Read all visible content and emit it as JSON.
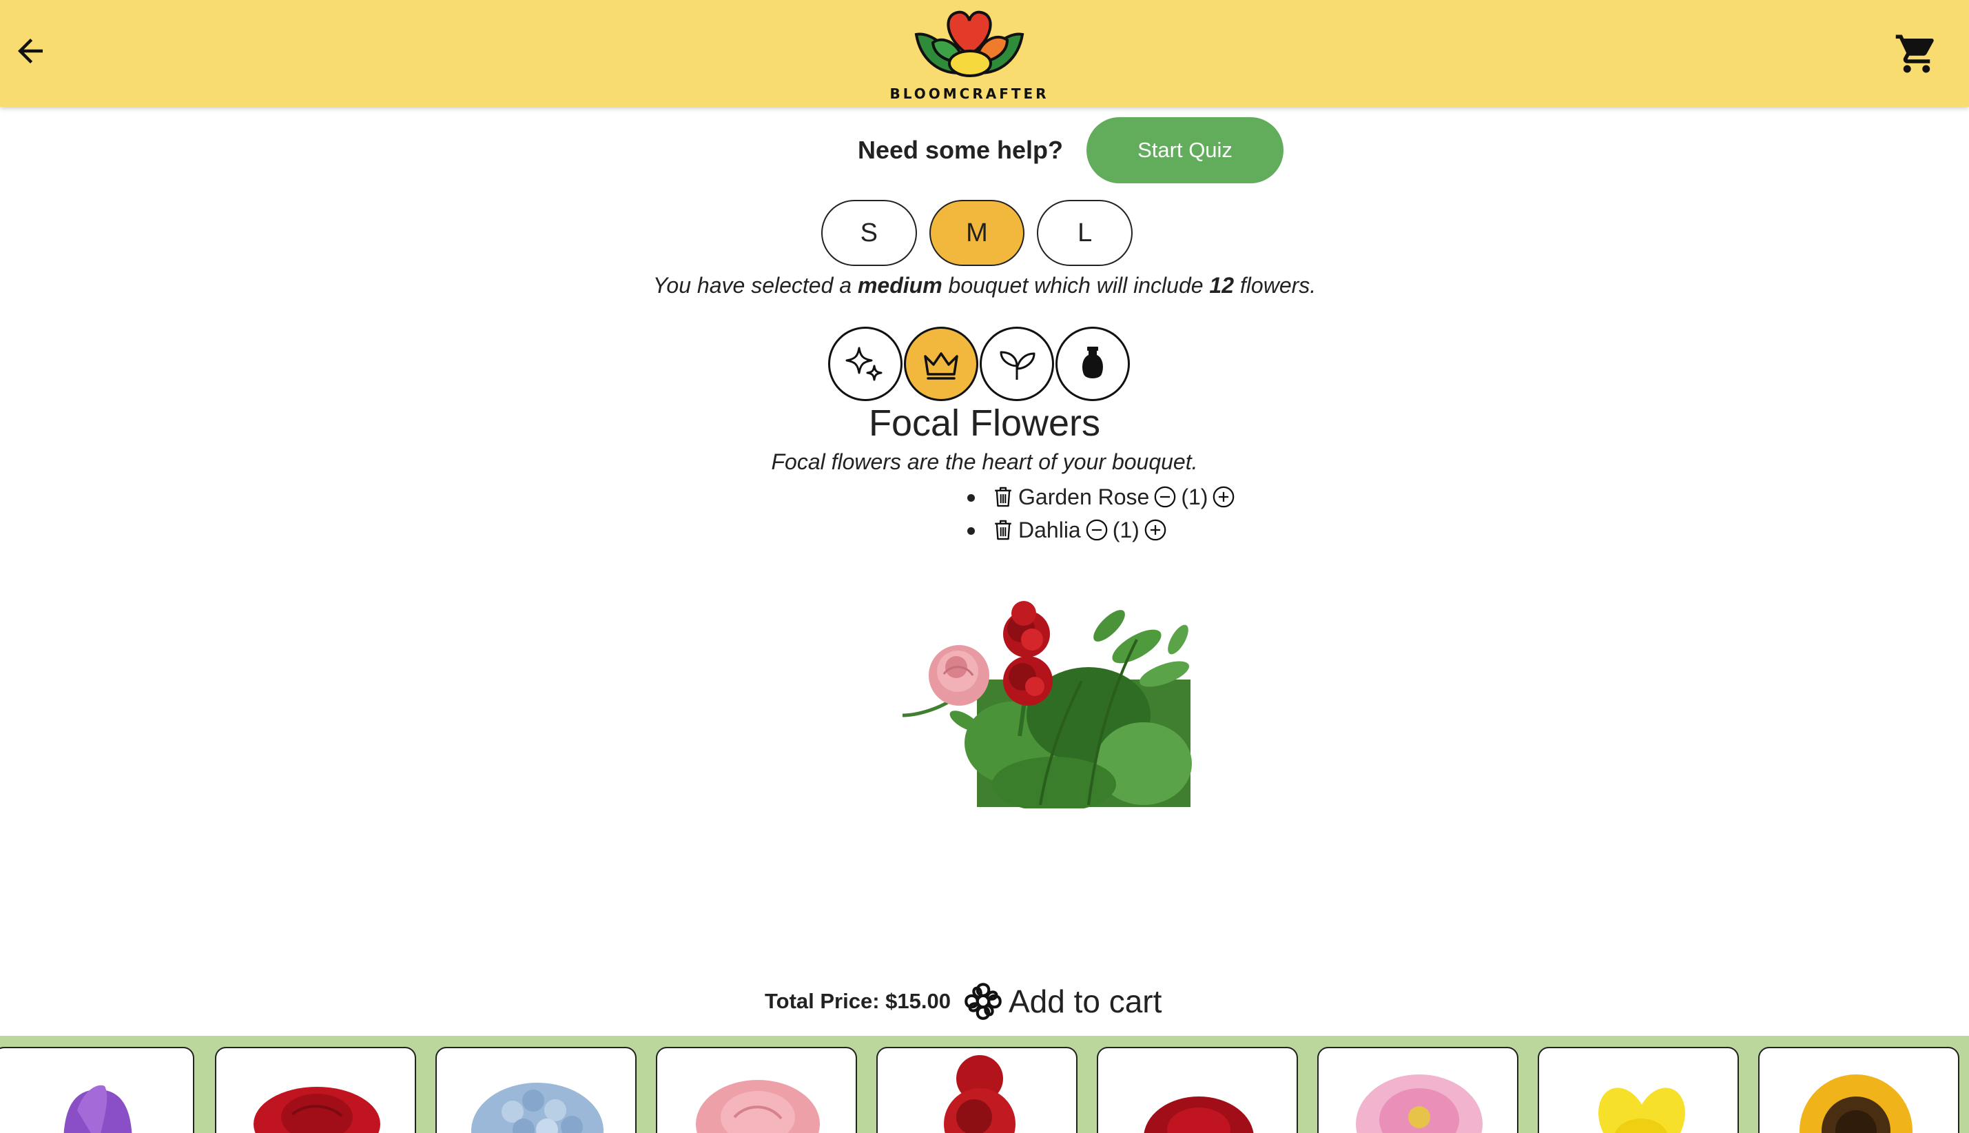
{
  "header": {
    "logo_text": "BLOOMCRAFTER",
    "back_icon": "arrow-left-icon",
    "cart_icon": "shopping-cart-icon",
    "bg_color": "#f8dc70"
  },
  "help": {
    "text": "Need some help?",
    "quiz_button": "Start Quiz",
    "quiz_color": "#62ad5b"
  },
  "sizes": {
    "options": [
      "S",
      "M",
      "L"
    ],
    "selected": "M",
    "accent": "#f2b73d"
  },
  "selection": {
    "prefix": "You have selected a ",
    "size_word": "medium",
    "middle": " bouquet which will include ",
    "count": "12",
    "suffix": " flowers."
  },
  "categories": {
    "icons": [
      "sparkles-icon",
      "crown-icon",
      "sprout-icon",
      "vase-icon"
    ],
    "selected_index": 1,
    "title": "Focal Flowers",
    "description": "Focal flowers are the heart of your bouquet."
  },
  "picked": [
    {
      "name": "Garden Rose",
      "qty": "(1)"
    },
    {
      "name": "Dahlia",
      "qty": "(1)"
    }
  ],
  "footer": {
    "total": "Total Price: $15.00",
    "add_to_cart": "Add to cart"
  },
  "tray": {
    "flowers": [
      "Tulip",
      "Red Rose",
      "Hydrangea",
      "Garden Rose",
      "Dahlia",
      "Carnation",
      "Pink Dahlia",
      "Daffodil",
      "Sunflower"
    ],
    "bg_color": "#bcd79b"
  }
}
